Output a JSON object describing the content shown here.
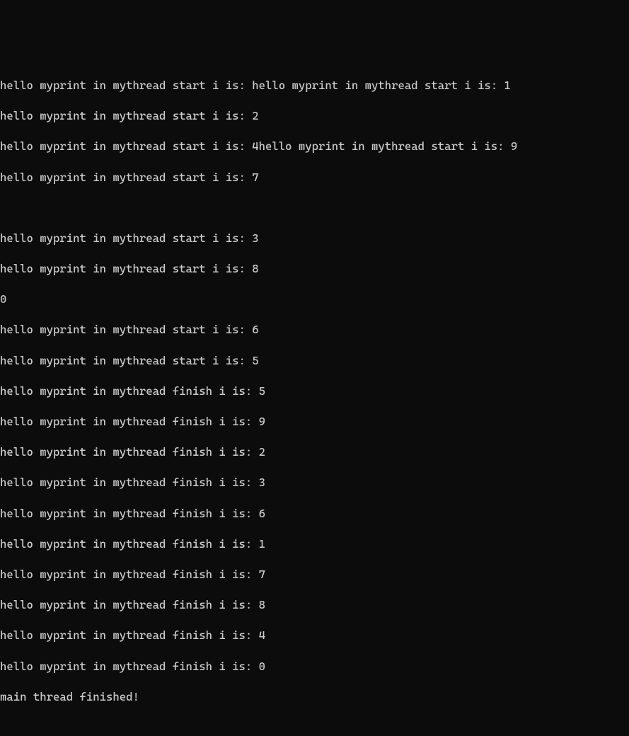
{
  "terminal": {
    "lines": [
      "hello myprint in mythread start i is: hello myprint in mythread start i is: 1",
      "hello myprint in mythread start i is: 2",
      "hello myprint in mythread start i is: 4hello myprint in mythread start i is: 9",
      "hello myprint in mythread start i is: 7",
      "",
      "hello myprint in mythread start i is: 3",
      "hello myprint in mythread start i is: 8",
      "0",
      "hello myprint in mythread start i is: 6",
      "hello myprint in mythread start i is: 5",
      "hello myprint in mythread finish i is: 5",
      "hello myprint in mythread finish i is: 9",
      "hello myprint in mythread finish i is: 2",
      "hello myprint in mythread finish i is: 3",
      "hello myprint in mythread finish i is: 6",
      "hello myprint in mythread finish i is: 1",
      "hello myprint in mythread finish i is: 7",
      "hello myprint in mythread finish i is: 8",
      "hello myprint in mythread finish i is: 4",
      "hello myprint in mythread finish i is: 0",
      "main thread finished!"
    ]
  }
}
